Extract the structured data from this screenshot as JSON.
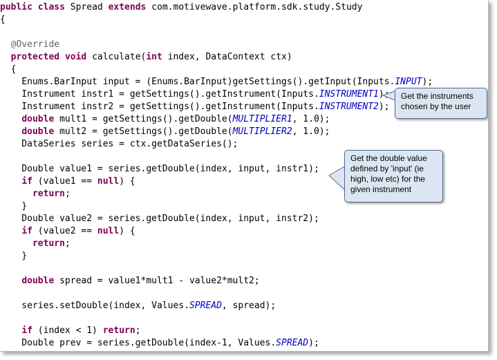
{
  "code_lines": [
    {
      "i": 0,
      "parts": [
        [
          "kw",
          "public"
        ],
        [
          "t",
          " "
        ],
        [
          "kw",
          "class"
        ],
        [
          "t",
          " Spread "
        ],
        [
          "kw",
          "extends"
        ],
        [
          "t",
          " com.motivewave.platform.sdk.study.Study"
        ]
      ]
    },
    {
      "i": 1,
      "parts": [
        [
          "t",
          "{"
        ]
      ]
    },
    {
      "i": 2,
      "parts": []
    },
    {
      "i": 3,
      "parts": [
        [
          "t",
          "  "
        ],
        [
          "ann",
          "@Override"
        ]
      ]
    },
    {
      "i": 4,
      "parts": [
        [
          "t",
          "  "
        ],
        [
          "kw",
          "protected"
        ],
        [
          "t",
          " "
        ],
        [
          "kw",
          "void"
        ],
        [
          "t",
          " calculate("
        ],
        [
          "kw",
          "int"
        ],
        [
          "t",
          " index, DataContext ctx)"
        ]
      ]
    },
    {
      "i": 5,
      "parts": [
        [
          "t",
          "  {"
        ]
      ]
    },
    {
      "i": 6,
      "parts": [
        [
          "t",
          "    Enums.BarInput input = (Enums.BarInput)getSettings().getInput(Inputs."
        ],
        [
          "fld",
          "INPUT"
        ],
        [
          "t",
          ");"
        ]
      ]
    },
    {
      "i": 7,
      "parts": [
        [
          "t",
          "    Instrument instr1 = getSettings().getInstrument(Inputs."
        ],
        [
          "fld",
          "INSTRUMENT1"
        ],
        [
          "t",
          ");"
        ]
      ]
    },
    {
      "i": 8,
      "parts": [
        [
          "t",
          "    Instrument instr2 = getSettings().getInstrument(Inputs."
        ],
        [
          "fld",
          "INSTRUMENT2"
        ],
        [
          "t",
          ");"
        ]
      ]
    },
    {
      "i": 9,
      "parts": [
        [
          "t",
          "    "
        ],
        [
          "kw",
          "double"
        ],
        [
          "t",
          " mult1 = getSettings().getDouble("
        ],
        [
          "fld",
          "MULTIPLIER1"
        ],
        [
          "t",
          ", 1.0);"
        ]
      ]
    },
    {
      "i": 10,
      "parts": [
        [
          "t",
          "    "
        ],
        [
          "kw",
          "double"
        ],
        [
          "t",
          " mult2 = getSettings().getDouble("
        ],
        [
          "fld",
          "MULTIPLIER2"
        ],
        [
          "t",
          ", 1.0);"
        ]
      ]
    },
    {
      "i": 11,
      "parts": [
        [
          "t",
          "    DataSeries series = ctx.getDataSeries();"
        ]
      ]
    },
    {
      "i": 12,
      "parts": []
    },
    {
      "i": 13,
      "parts": [
        [
          "t",
          "    Double value1 = series.getDouble(index, input, instr1);"
        ]
      ]
    },
    {
      "i": 14,
      "parts": [
        [
          "t",
          "    "
        ],
        [
          "kw",
          "if"
        ],
        [
          "t",
          " (value1 == "
        ],
        [
          "kw",
          "null"
        ],
        [
          "t",
          ") {"
        ]
      ]
    },
    {
      "i": 15,
      "parts": [
        [
          "t",
          "      "
        ],
        [
          "kw",
          "return"
        ],
        [
          "t",
          ";"
        ]
      ]
    },
    {
      "i": 16,
      "parts": [
        [
          "t",
          "    }"
        ]
      ]
    },
    {
      "i": 17,
      "parts": [
        [
          "t",
          "    Double value2 = series.getDouble(index, input, instr2);"
        ]
      ]
    },
    {
      "i": 18,
      "parts": [
        [
          "t",
          "    "
        ],
        [
          "kw",
          "if"
        ],
        [
          "t",
          " (value2 == "
        ],
        [
          "kw",
          "null"
        ],
        [
          "t",
          ") {"
        ]
      ]
    },
    {
      "i": 19,
      "parts": [
        [
          "t",
          "      "
        ],
        [
          "kw",
          "return"
        ],
        [
          "t",
          ";"
        ]
      ]
    },
    {
      "i": 20,
      "parts": [
        [
          "t",
          "    }"
        ]
      ]
    },
    {
      "i": 21,
      "parts": []
    },
    {
      "i": 22,
      "parts": [
        [
          "t",
          "    "
        ],
        [
          "kw",
          "double"
        ],
        [
          "t",
          " spread = value1*mult1 - value2*mult2;"
        ]
      ]
    },
    {
      "i": 23,
      "parts": []
    },
    {
      "i": 24,
      "parts": [
        [
          "t",
          "    series.setDouble(index, Values."
        ],
        [
          "fld",
          "SPREAD"
        ],
        [
          "t",
          ", spread);"
        ]
      ]
    },
    {
      "i": 25,
      "parts": []
    },
    {
      "i": 26,
      "parts": [
        [
          "t",
          "    "
        ],
        [
          "kw",
          "if"
        ],
        [
          "t",
          " (index < 1) "
        ],
        [
          "kw",
          "return"
        ],
        [
          "t",
          ";"
        ]
      ]
    },
    {
      "i": 27,
      "parts": [
        [
          "t",
          "    Double prev = series.getDouble(index-1, Values."
        ],
        [
          "fld",
          "SPREAD"
        ],
        [
          "t",
          ");"
        ]
      ]
    }
  ],
  "callouts": {
    "instruments": "Get the instruments chosen by the user",
    "double_value": "Get the double value defined by 'input' (ie high, low etc) for the given instrument"
  },
  "colors": {
    "keyword": "#7f0055",
    "annotation": "#646464",
    "field": "#0000c0",
    "callout_fill": "#dce6f2",
    "callout_border": "#4f6a8f"
  }
}
